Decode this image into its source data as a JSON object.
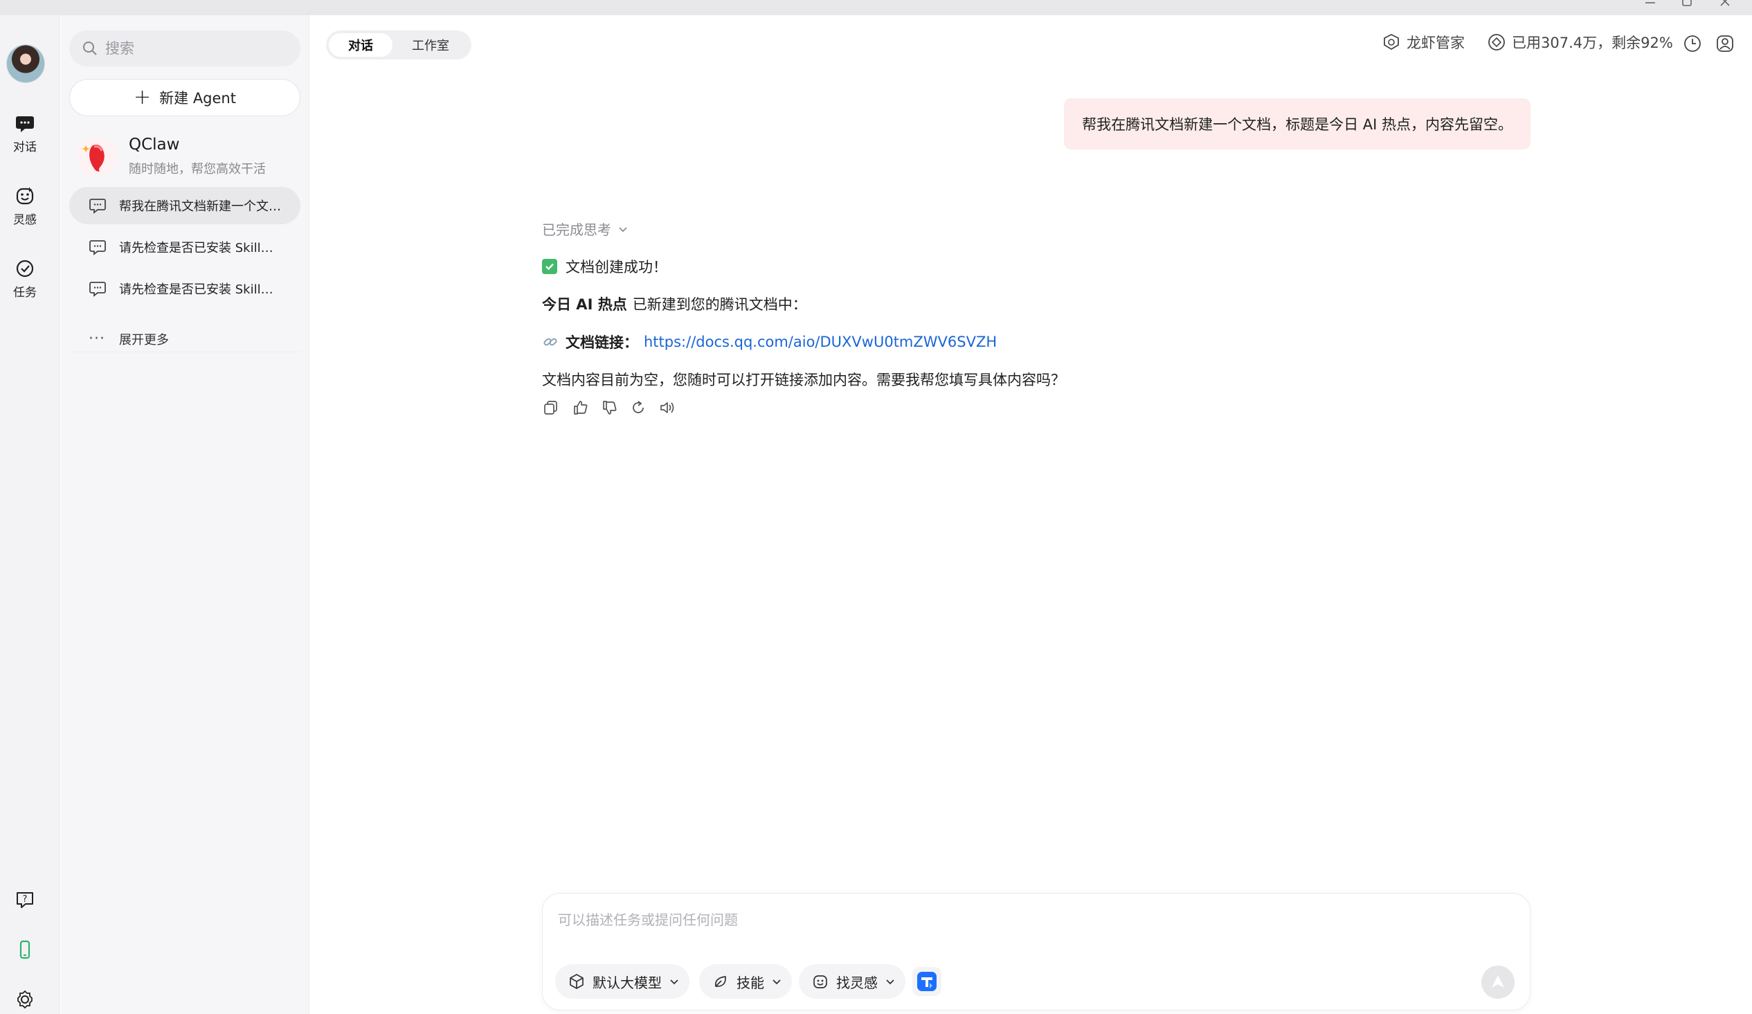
{
  "window": {
    "controls": [
      "minimize",
      "maximize",
      "close"
    ]
  },
  "rail": {
    "items": [
      {
        "label": "对话",
        "icon": "chat-bubble-icon"
      },
      {
        "label": "灵感",
        "icon": "inspiration-face-icon"
      },
      {
        "label": "任务",
        "icon": "task-check-icon"
      }
    ],
    "bottom_icons": [
      "help-icon",
      "phone-icon",
      "settings-icon"
    ],
    "accent": "#2fb36b"
  },
  "sidebar": {
    "search_placeholder": "搜索",
    "new_agent_label": "新建 Agent",
    "agent": {
      "name": "QClaw",
      "subtitle": "随时随地，帮您高效干活"
    },
    "chats": [
      {
        "label": "帮我在腾讯文档新建一个文档，标题是今日 AI 热点，内容先留空。",
        "active": true
      },
      {
        "label": "请先检查是否已安装 SkillHub",
        "active": false
      },
      {
        "label": "请先检查是否已安装 SkillHub",
        "active": false
      }
    ],
    "more_label": "展开更多"
  },
  "header": {
    "tabs": [
      {
        "label": "对话",
        "active": true
      },
      {
        "label": "工作室",
        "active": false
      }
    ],
    "butler_label": "龙虾管家",
    "quota_label": "已用307.4万，剩余92%",
    "icons": [
      "history-clock-icon",
      "account-icon"
    ]
  },
  "conversation": {
    "user_message": "帮我在腾讯文档新建一个文档，标题是今日 AI 热点，内容先留空。",
    "thinking_label": "已完成思考",
    "reply": {
      "success": "文档创建成功！",
      "doc_title": "今日 AI 热点",
      "created_text": "已新建到您的腾讯文档中：",
      "link_label": "文档链接：",
      "link_url": "https://docs.qq.com/aio/DUXVwU0tmZWV6SVZH",
      "followup": "文档内容目前为空，您随时可以打开链接添加内容。需要我帮您填写具体内容吗？"
    },
    "actions": [
      "copy-icon",
      "thumbs-up-icon",
      "thumbs-down-icon",
      "regenerate-icon",
      "speaker-icon"
    ]
  },
  "composer": {
    "placeholder": "可以描述任务或提问任何问题",
    "model_label": "默认大模型",
    "skills_label": "技能",
    "inspiration_label": "找灵感",
    "send_icon": "send-arrow-icon"
  }
}
